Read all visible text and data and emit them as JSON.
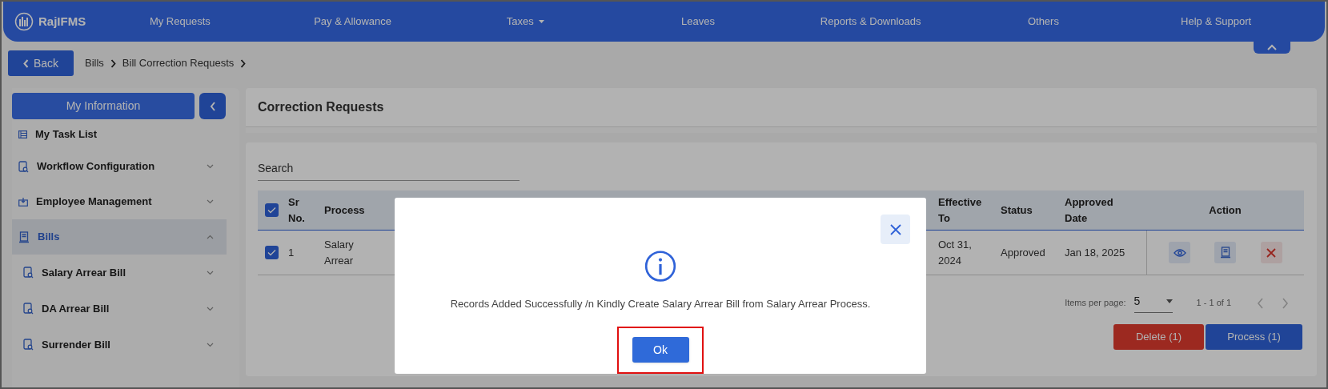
{
  "brand": {
    "name": "RajIFMS"
  },
  "nav": {
    "items": [
      {
        "label": "My Requests",
        "dropdown": false
      },
      {
        "label": "Pay & Allowance",
        "dropdown": false
      },
      {
        "label": "Taxes",
        "dropdown": true
      },
      {
        "label": "Leaves",
        "dropdown": false
      },
      {
        "label": "Reports & Downloads",
        "dropdown": false
      },
      {
        "label": "Others",
        "dropdown": false
      },
      {
        "label": "Help & Support",
        "dropdown": false
      }
    ]
  },
  "breadcrumb": {
    "back": "Back",
    "items": [
      "Bills",
      "Bill Correction Requests"
    ]
  },
  "sidebar": {
    "header": "My Information",
    "items": [
      {
        "label": "My Task List",
        "kind": "link",
        "selected": false
      },
      {
        "label": "Workflow Configuration",
        "kind": "group",
        "expanded": false,
        "selected": false
      },
      {
        "label": "Employee Management",
        "kind": "group",
        "expanded": false,
        "selected": false
      },
      {
        "label": "Bills",
        "kind": "group",
        "expanded": true,
        "selected": true,
        "children": [
          {
            "label": "Salary Arrear Bill",
            "kind": "group",
            "expanded": false,
            "selected": false
          },
          {
            "label": "DA Arrear Bill",
            "kind": "group",
            "expanded": false,
            "selected": false
          },
          {
            "label": "Surrender Bill",
            "kind": "group",
            "expanded": false,
            "selected": false
          }
        ]
      }
    ]
  },
  "page": {
    "title": "Correction Requests"
  },
  "search": {
    "placeholder": "Search"
  },
  "table": {
    "header_checked": true,
    "columns": [
      "Sr No.",
      "Process",
      "Effective To",
      "Status",
      "Approved Date",
      "Action"
    ],
    "rows": [
      {
        "checked": true,
        "cells": [
          "1",
          "Salary Arrear",
          "Oct 31, 2024",
          "Approved",
          "Jan 18, 2025"
        ]
      }
    ]
  },
  "pagination": {
    "label": "Items per page:",
    "page_size": "5",
    "range": "1 - 1 of 1"
  },
  "actions": [
    {
      "label": "Delete (1)",
      "kind": "danger"
    },
    {
      "label": "Process (1)",
      "kind": "primary"
    }
  ],
  "dialog": {
    "message": "Records Added Successfully /n Kindly Create Salary Arrear Bill from Salary Arrear Process.",
    "button": "Ok",
    "button_highlighted": true
  }
}
